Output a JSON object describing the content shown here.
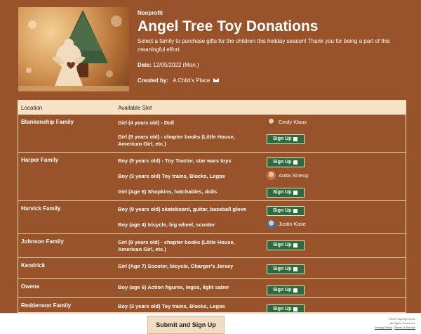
{
  "header": {
    "org_type": "Nonprofit",
    "title": "Angel Tree Toy Donations",
    "description": "Select a family to purchase gifts for the children this holiday season! Thank you for being a part of this meaningful effort.",
    "date_label": "Date:",
    "date_value": "12/05/2022 (Mon.)",
    "creator_label": "Created by:",
    "creator_value": "A Child's Place"
  },
  "table": {
    "col_location": "Location",
    "col_slot": "Available Slot",
    "signup_label": "Sign Up",
    "groups": [
      {
        "location": "Blankenship Family",
        "slots": [
          {
            "text1": "Girl (4 years old) - Doll",
            "text2": "",
            "taken_by": "Cindy Klaus"
          },
          {
            "text1": "Girl (8 years old) - chapter books (Little House,",
            "text2": "American Girl, etc.)",
            "taken_by": ""
          }
        ]
      },
      {
        "location": "Harper Family",
        "slots": [
          {
            "text1": "Boy (5 years old) - Toy Tractor, star wars toys",
            "text2": "",
            "taken_by": ""
          },
          {
            "text1": "Boy (3 years old) Toy trains, Blocks, Legos",
            "text2": "",
            "taken_by": "Anita Sineup"
          },
          {
            "text1": "Girl (Age 6) Shopkins, hatchables, dolls",
            "text2": "",
            "taken_by": ""
          }
        ]
      },
      {
        "location": "Harvick Family",
        "slots": [
          {
            "text1": "Boy (9 years old) skateboard, guitar, baseball glove",
            "text2": "",
            "taken_by": ""
          },
          {
            "text1": "Boy (age 4) tricycle, big wheel, scooter",
            "text2": "",
            "taken_by": "Justin Kase"
          }
        ]
      },
      {
        "location": "Johnson Family",
        "slots": [
          {
            "text1": "Girl (8 years old) - chapter books (Little House,",
            "text2": "American Girl, etc.)",
            "taken_by": ""
          }
        ]
      },
      {
        "location": "Kendrick",
        "slots": [
          {
            "text1": "Girl (Age 7) Scooter, bicycle, Charger's Jersey",
            "text2": "",
            "taken_by": ""
          }
        ]
      },
      {
        "location": "Owens",
        "slots": [
          {
            "text1": "Boy (age 6) Action figures, legos, light saber",
            "text2": "",
            "taken_by": ""
          }
        ]
      },
      {
        "location": "Reddenson Family",
        "slots": [
          {
            "text1": "Boy (3 years old) Toy trains, Blocks, Legos",
            "text2": "",
            "taken_by": ""
          }
        ]
      }
    ]
  },
  "footer": {
    "submit_label": "Submit and Sign Up",
    "copyright_line1": "©2022 SignUpGenius",
    "copyright_line2": "All Rights Reserved.",
    "privacy_label": "Privacy Policy",
    "separator": "|",
    "terms_label": "Terms of Service"
  },
  "colors": {
    "page_bg": "#98532a",
    "header_row_bg": "#f7e2c6",
    "signup_button": "#2f6a3c"
  },
  "icons": [
    "mail-icon",
    "checkbox-icon",
    "angel-tree-image"
  ]
}
